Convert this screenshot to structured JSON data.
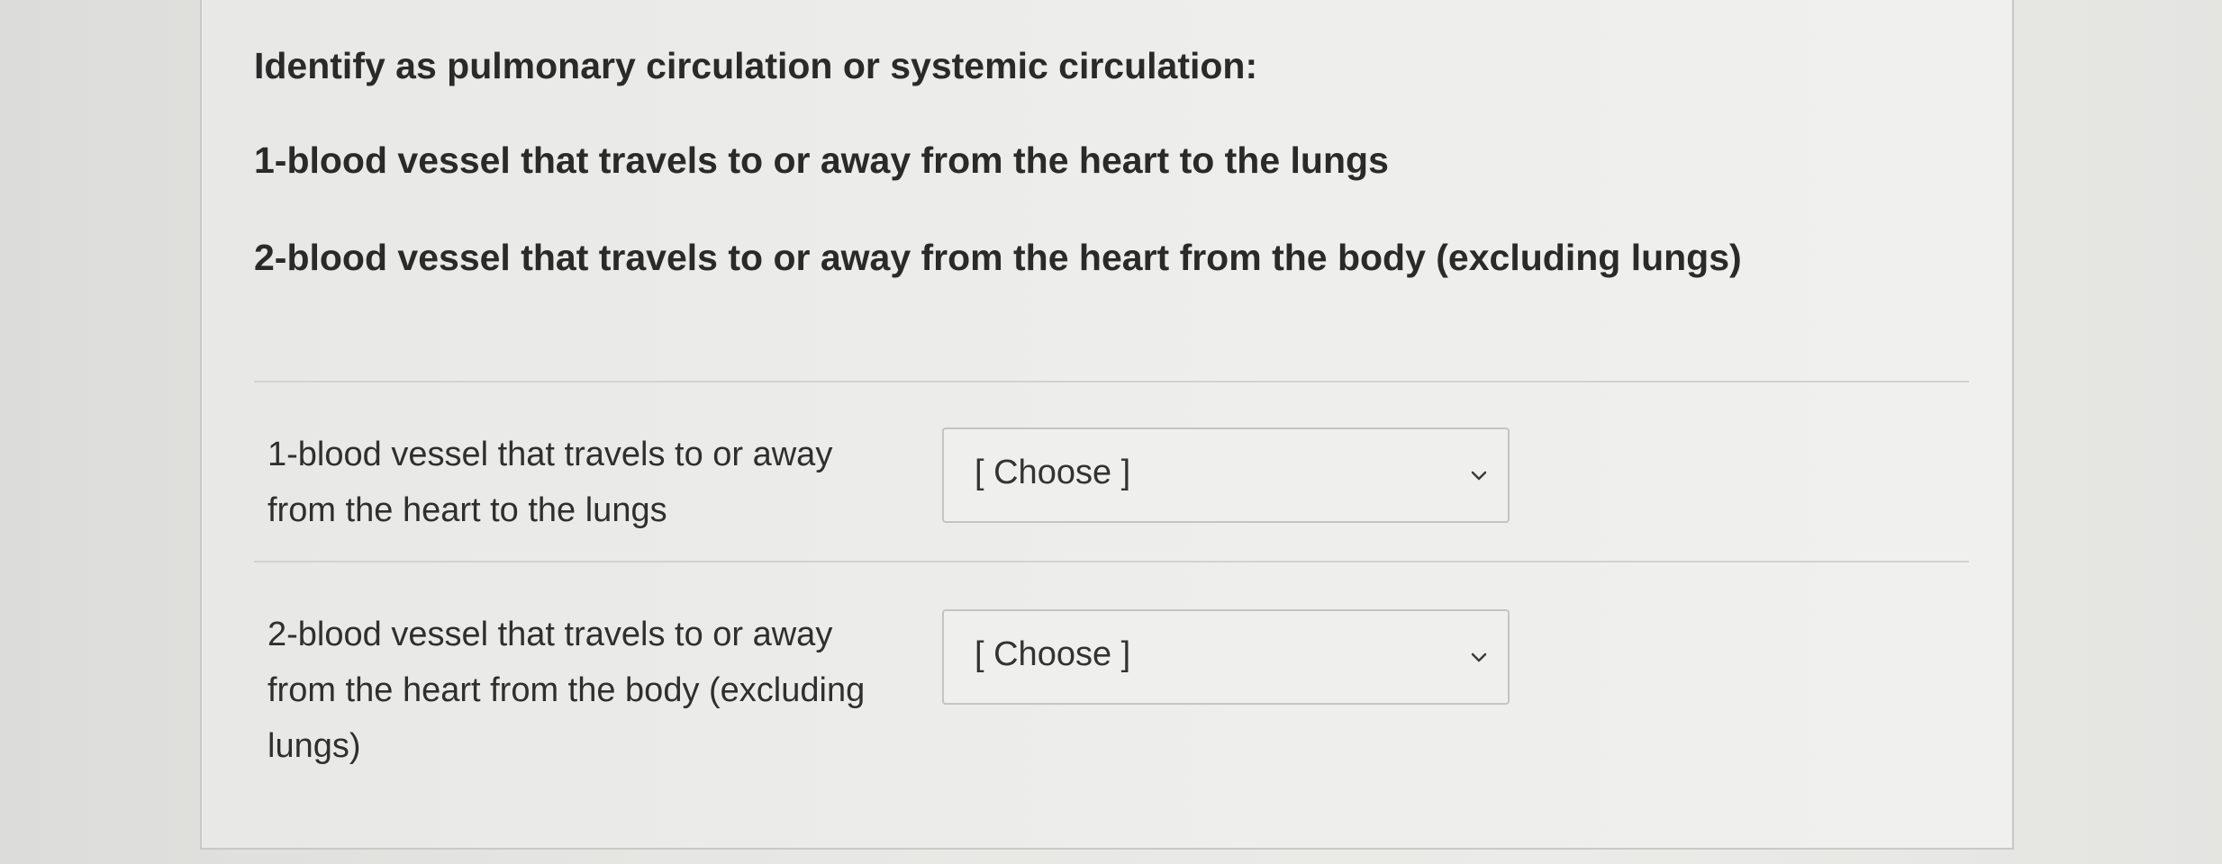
{
  "question": {
    "title": "Identify as pulmonary circulation or systemic circulation:",
    "item1": "1-blood vessel that travels to or away from the heart to the lungs",
    "item2": "2-blood vessel that travels to or away from the heart from the body (excluding lungs)"
  },
  "matches": [
    {
      "label_lines": [
        "1-blood vessel that travels to or away",
        "from the heart to the lungs"
      ],
      "selected": "[ Choose ]",
      "icon": "chevron-down-icon"
    },
    {
      "label_lines": [
        "2-blood vessel that travels to or away",
        "from the heart from the body (excluding",
        "lungs)"
      ],
      "selected": "[ Choose ]",
      "icon": "chevron-down-icon"
    }
  ]
}
